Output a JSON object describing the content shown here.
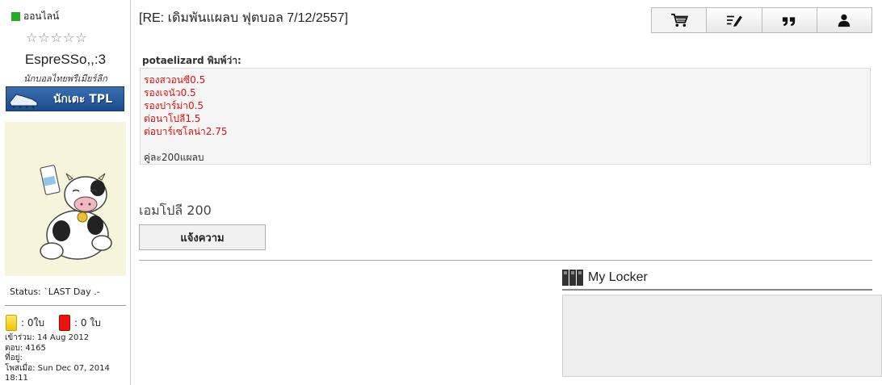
{
  "profile": {
    "online_label": "ออนไลน์",
    "stars": "☆☆☆☆☆",
    "username": "EspreSSo,,:3",
    "rank_title": "นักบอลไทยพรีเมียร์ลีก",
    "rank_badge": "นักเตะ TPL",
    "status": "Status: `LAST Day .-",
    "yellow_cards": ": 0ใบ",
    "red_cards": ": 0 ใบ",
    "joined": "เข้าร่วม: 14 Aug 2012",
    "replies": "ตอบ: 4165",
    "location": "ที่อยู่:",
    "posted": "โพสเมื่อ: Sun Dec 07, 2014 18:11"
  },
  "post": {
    "title": "[RE: เดิมพันแผลบ ฟุตบอล 7/12/2557]",
    "quote_author": "potaelizard พิมพ์ว่า:",
    "quote_lines": [
      "รองสวอนซี0.5",
      "รองเจนัว0.5",
      "รองปาร์ม่า0.5",
      "ต่อนาโปลี1.5",
      "ต่อบาร์เซโลน่า2.75"
    ],
    "quote_footer": "คู่ละ200แผลบ",
    "reply_text": "เอมโปลี 200",
    "report_button": "แจ้งความ"
  },
  "toolbar": {
    "icons": [
      "cart-icon",
      "edit-icon",
      "quote-icon",
      "profile-icon"
    ]
  },
  "locker": {
    "title": "My Locker"
  },
  "colors": {
    "online": "#22aa22",
    "quote_red": "#dd1111",
    "badge_blue": "#1c4b8c"
  }
}
